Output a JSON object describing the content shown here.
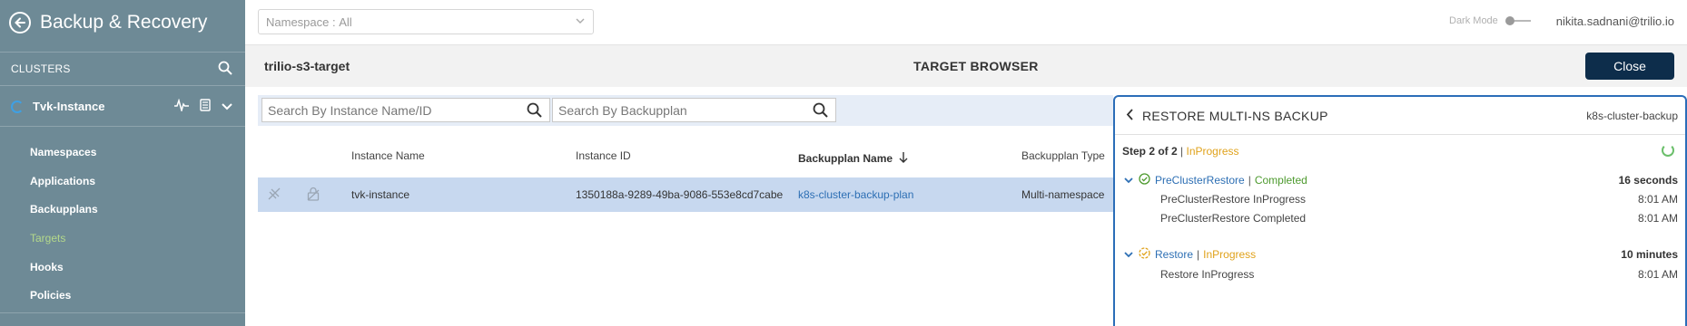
{
  "app": {
    "title": "Backup & Recovery"
  },
  "sidebar": {
    "clusters_label": "CLUSTERS",
    "instance_name": "Tvk-Instance",
    "items": [
      {
        "label": "Namespaces"
      },
      {
        "label": "Applications"
      },
      {
        "label": "Backupplans"
      },
      {
        "label": "Targets",
        "active": true
      },
      {
        "label": "Hooks"
      },
      {
        "label": "Policies"
      }
    ]
  },
  "topbar": {
    "namespace_label": "Namespace :",
    "namespace_value": "All",
    "dark_mode_label": "Dark Mode",
    "user": "nikita.sadnani@trilio.io"
  },
  "header": {
    "target_name": "trilio-s3-target",
    "title": "TARGET BROWSER",
    "close_label": "Close"
  },
  "search": {
    "instance_placeholder": "Search By Instance Name/ID",
    "backupplan_placeholder": "Search By Backupplan"
  },
  "table": {
    "columns": [
      "Instance Name",
      "Instance ID",
      "Backupplan Name",
      "Backupplan Type"
    ],
    "rows": [
      {
        "instance_name": "tvk-instance",
        "instance_id": "1350188a-9289-49ba-9086-553e8cd7cabe",
        "backupplan_name": "k8s-cluster-backup-plan",
        "backupplan_type": "Multi-namespace"
      }
    ]
  },
  "restore_panel": {
    "title": "RESTORE MULTI-NS BACKUP",
    "plan": "k8s-cluster-backup",
    "step_label": "Step 2 of 2",
    "step_status": "InProgress",
    "sections": [
      {
        "name": "PreClusterRestore",
        "status": "Completed",
        "duration": "16 seconds",
        "events": [
          {
            "text": "PreClusterRestore InProgress",
            "time": "8:01 AM"
          },
          {
            "text": "PreClusterRestore Completed",
            "time": "8:01 AM"
          }
        ]
      },
      {
        "name": "Restore",
        "status": "InProgress",
        "duration": "10 minutes",
        "events": [
          {
            "text": "Restore InProgress",
            "time": "8:01 AM"
          }
        ]
      }
    ]
  },
  "colors": {
    "sidebar_bg": "#6e8a96",
    "active_item": "#b4d98a",
    "close_button": "#0d2d4b",
    "link": "#2d6fb4",
    "completed": "#4d9a2e",
    "in_progress": "#e0a21b",
    "panel_border": "#2b6db8"
  }
}
